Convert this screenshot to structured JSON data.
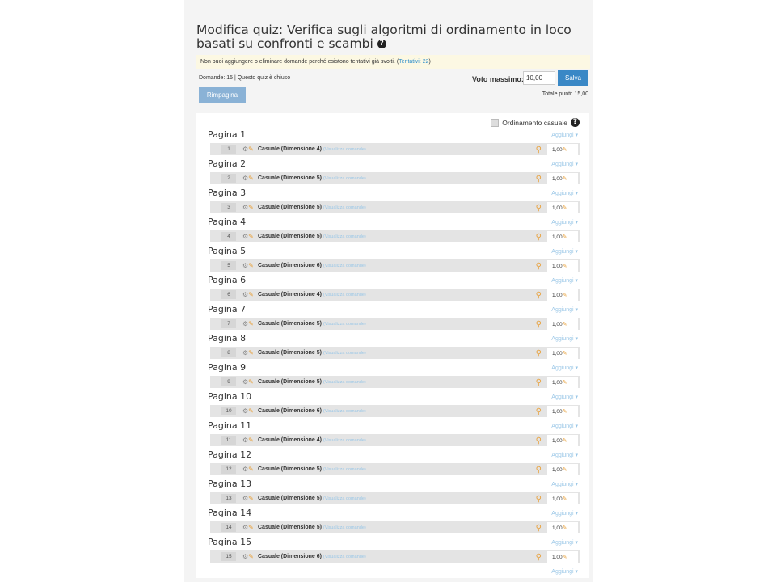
{
  "header": {
    "title": "Modifica quiz: Verifica sugli algoritmi di ordinamento in loco basati su confronti e scambi",
    "help_icon": "question-circle-icon"
  },
  "alert": {
    "text": "Non puoi aggiungere o eliminare domande perché esistono tentativi già svolti. (",
    "link": "Tentativi: 22",
    "text_after": ")"
  },
  "info": {
    "status": "Domande: 15 | Questo quiz è chiuso",
    "voto_label": "Voto massimo:",
    "voto_value": "10,00",
    "save_label": "Salva",
    "repaginate_label": "Rimpagina",
    "total": "Totale punti: 15,00"
  },
  "options": {
    "shuffle_label": "Ordinamento casuale"
  },
  "add_label": "Aggiungi ▾",
  "view_questions_label": "(Visualizza domande)",
  "pages": [
    {
      "label": "Pagina 1",
      "num": "1",
      "name": "Casuale (Dimensione 4)",
      "mark": "1,00"
    },
    {
      "label": "Pagina 2",
      "num": "2",
      "name": "Casuale (Dimensione 5)",
      "mark": "1,00"
    },
    {
      "label": "Pagina 3",
      "num": "3",
      "name": "Casuale (Dimensione 5)",
      "mark": "1,00"
    },
    {
      "label": "Pagina 4",
      "num": "4",
      "name": "Casuale (Dimensione 5)",
      "mark": "1,00"
    },
    {
      "label": "Pagina 5",
      "num": "5",
      "name": "Casuale (Dimensione 6)",
      "mark": "1,00"
    },
    {
      "label": "Pagina 6",
      "num": "6",
      "name": "Casuale (Dimensione 4)",
      "mark": "1,00"
    },
    {
      "label": "Pagina 7",
      "num": "7",
      "name": "Casuale (Dimensione 5)",
      "mark": "1,00"
    },
    {
      "label": "Pagina 8",
      "num": "8",
      "name": "Casuale (Dimensione 5)",
      "mark": "1,00"
    },
    {
      "label": "Pagina 9",
      "num": "9",
      "name": "Casuale (Dimensione 5)",
      "mark": "1,00"
    },
    {
      "label": "Pagina 10",
      "num": "10",
      "name": "Casuale (Dimensione 6)",
      "mark": "1,00"
    },
    {
      "label": "Pagina 11",
      "num": "11",
      "name": "Casuale (Dimensione 4)",
      "mark": "1,00"
    },
    {
      "label": "Pagina 12",
      "num": "12",
      "name": "Casuale (Dimensione 5)",
      "mark": "1,00"
    },
    {
      "label": "Pagina 13",
      "num": "13",
      "name": "Casuale (Dimensione 5)",
      "mark": "1,00"
    },
    {
      "label": "Pagina 14",
      "num": "14",
      "name": "Casuale (Dimensione 5)",
      "mark": "1,00"
    },
    {
      "label": "Pagina 15",
      "num": "15",
      "name": "Casuale (Dimensione 6)",
      "mark": "1,00"
    }
  ],
  "colors": {
    "accent": "#3a88c6",
    "link": "#9ac7e7",
    "alert_bg": "#fcf8e3",
    "slot_bg": "#e4e4e4"
  }
}
